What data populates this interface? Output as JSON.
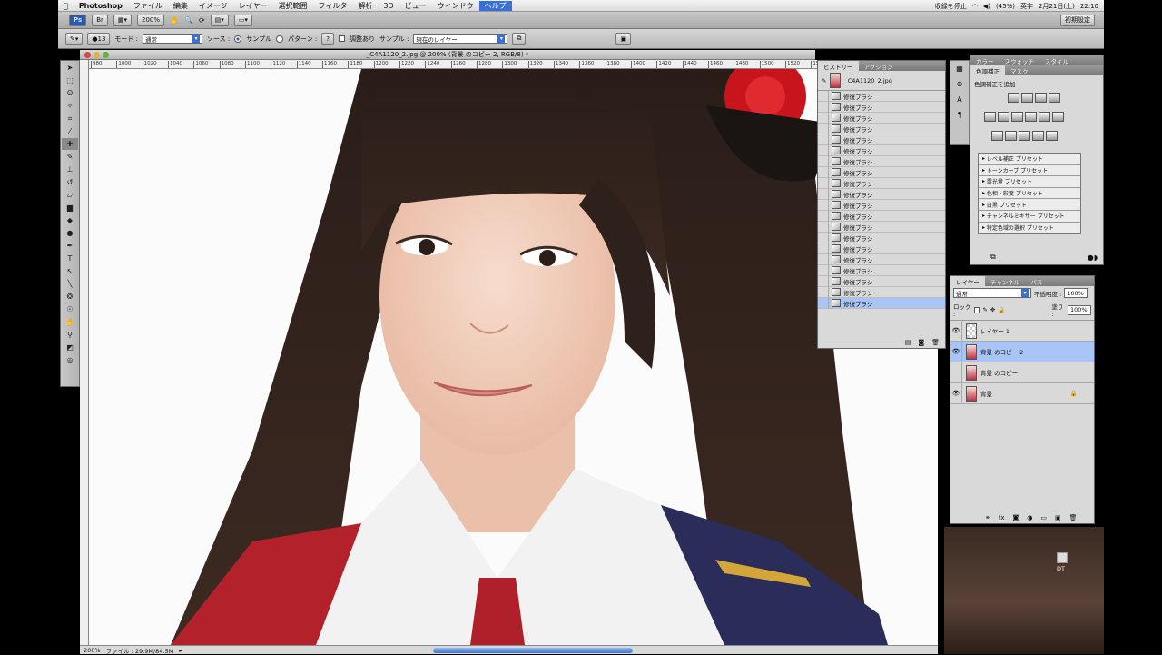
{
  "menubar": {
    "items": [
      "Photoshop",
      "ファイル",
      "編集",
      "イメージ",
      "レイヤー",
      "選択範囲",
      "フィルタ",
      "解析",
      "3D",
      "ビュー",
      "ウィンドウ",
      "ヘルプ"
    ],
    "active_index": 11,
    "right": {
      "record": "収録を停止",
      "battery": "(45%)",
      "ime": "英字",
      "datetime": "2月21日(土)",
      "time": "22:10"
    }
  },
  "appbar": {
    "zoom": "200%",
    "workspace": "初期設定"
  },
  "options": {
    "brush_size": "13",
    "mode_label": "モード :",
    "mode_value": "通常",
    "source_label": "ソース :",
    "source_sample": "サンプル",
    "source_pattern": "パターン :",
    "aligned_label": "調整あり",
    "sample_label": "サンプル :",
    "sample_value": "現在のレイヤー"
  },
  "document": {
    "title": "_C4A1120_2.jpg @ 200% (背景 のコピー 2, RGB/8) *",
    "ruler_ticks": [
      "980",
      "1000",
      "1020",
      "1040",
      "1060",
      "1080",
      "1100",
      "1120",
      "1140",
      "1160",
      "1180",
      "1200",
      "1220",
      "1240",
      "1260",
      "1280",
      "1300",
      "1320",
      "1340",
      "1360",
      "1380",
      "1400",
      "1420",
      "1440",
      "1460",
      "1480",
      "1500",
      "1520",
      "1540",
      "1560",
      "1580",
      "1600",
      "1620"
    ],
    "status_zoom": "200%",
    "status_file": "ファイル : 29.9M/84.5M"
  },
  "history": {
    "tabs": [
      "ヒストリー",
      "アクション"
    ],
    "snapshot": "_C4A1120_2.jpg",
    "items": [
      "修復ブラシ",
      "修復ブラシ",
      "修復ブラシ",
      "修復ブラシ",
      "修復ブラシ",
      "修復ブラシ",
      "修復ブラシ",
      "修復ブラシ",
      "修復ブラシ",
      "修復ブラシ",
      "修復ブラシ",
      "修復ブラシ",
      "修復ブラシ",
      "修復ブラシ",
      "修復ブラシ",
      "修復ブラシ",
      "修復ブラシ",
      "修復ブラシ",
      "修復ブラシ",
      "修復ブラシ"
    ],
    "active_index": 19
  },
  "adjustments": {
    "top_tabs": [
      "カラー",
      "スウォッチ",
      "スタイル"
    ],
    "tabs": [
      "色調補正",
      "マスク"
    ],
    "add_label": "色調補正を追加",
    "presets": [
      "レベル補正 プリセット",
      "トーンカーブ プリセット",
      "露光量 プリセット",
      "色相・彩度 プリセット",
      "白黒 プリセット",
      "チャンネルミキサー プリセット",
      "特定色域の選択 プリセット"
    ]
  },
  "layers": {
    "tabs": [
      "レイヤー",
      "チャンネル",
      "パス"
    ],
    "blend": "通常",
    "opacity_label": "不透明度 :",
    "opacity": "100%",
    "lock_label": "ロック :",
    "fill_label": "塗り :",
    "fill": "100%",
    "items": [
      {
        "name": "レイヤー 1",
        "visible": true,
        "active": false
      },
      {
        "name": "背景 のコピー 2",
        "visible": true,
        "active": true
      },
      {
        "name": "背景 のコピー",
        "visible": false,
        "active": false
      },
      {
        "name": "背景",
        "visible": true,
        "active": false
      }
    ]
  },
  "desktop": {
    "icon_label": "DT"
  }
}
